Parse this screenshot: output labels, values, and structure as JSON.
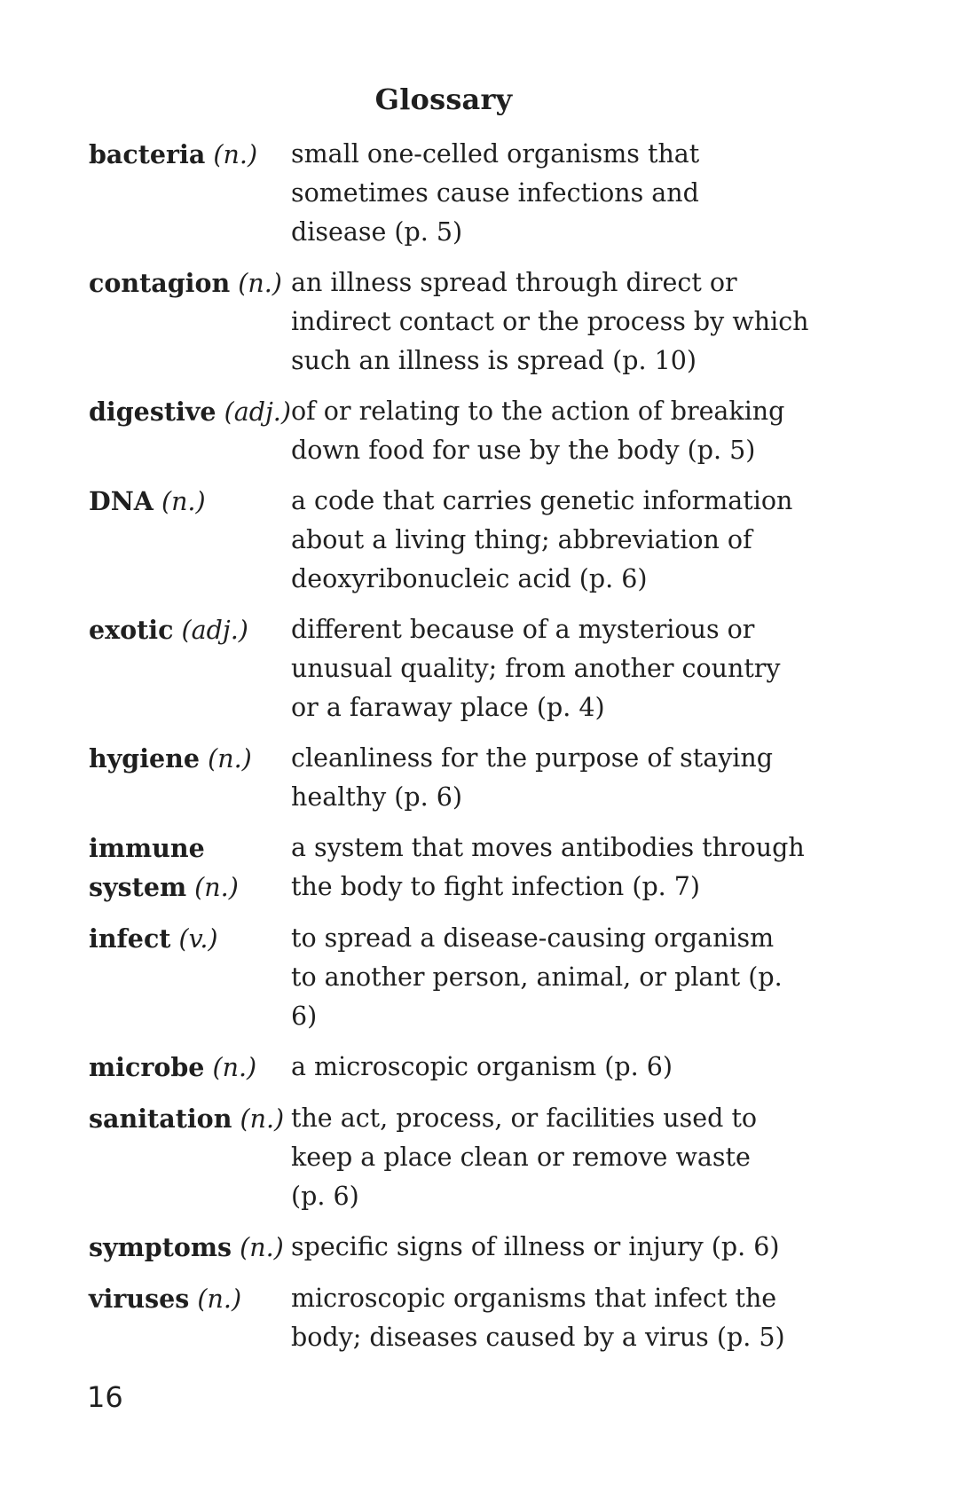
{
  "page": {
    "title": "Glossary",
    "page_number": "16"
  },
  "entries": [
    {
      "term": "bacteria",
      "pos": "(n.)",
      "definition": "small one-celled organisms that\nsometimes cause infections and\ndisease (p. 5)"
    },
    {
      "term": "contagion",
      "pos": "(n.)",
      "definition": "an illness spread through direct or\nindirect contact or the process by which\nsuch an illness is spread (p. 10)"
    },
    {
      "term": "digestive",
      "pos": "(adj.)",
      "definition": "of or relating to the action of breaking\ndown food for use by the body (p. 5)"
    },
    {
      "term": "DNA",
      "pos": "(n.)",
      "definition": "a code that carries genetic information\nabout a living thing; abbreviation of\ndeoxyribonucleic acid (p. 6)"
    },
    {
      "term": "exotic",
      "pos": "(adj.)",
      "definition": "different because of a mysterious or\nunusual quality; from another country\nor a faraway place (p. 4)"
    },
    {
      "term": "hygiene",
      "pos": "(n.)",
      "definition": "cleanliness for the purpose of staying\nhealthy (p. 6)"
    },
    {
      "term_line1": "immune",
      "term_line2": "system",
      "pos": "(n.)",
      "definition": "a system that moves antibodies through\nthe body to fight infection (p. 7)"
    },
    {
      "term": "infect",
      "pos": "(v.)",
      "definition": "to spread a disease-causing organism\nto another person, animal, or plant (p. 6)"
    },
    {
      "term": "microbe",
      "pos": "(n.)",
      "definition": "a microscopic organism (p. 6)"
    },
    {
      "term": "sanitation",
      "pos": "(n.)",
      "definition": "the act, process, or facilities used to\nkeep a place clean or remove waste\n(p. 6)"
    },
    {
      "term": "symptoms",
      "pos": "(n.)",
      "definition": "specific signs of illness or injury (p. 6)"
    },
    {
      "term": "viruses",
      "pos": "(n.)",
      "definition": "microscopic organisms that infect the\nbody; diseases caused by a virus (p. 5)"
    }
  ]
}
